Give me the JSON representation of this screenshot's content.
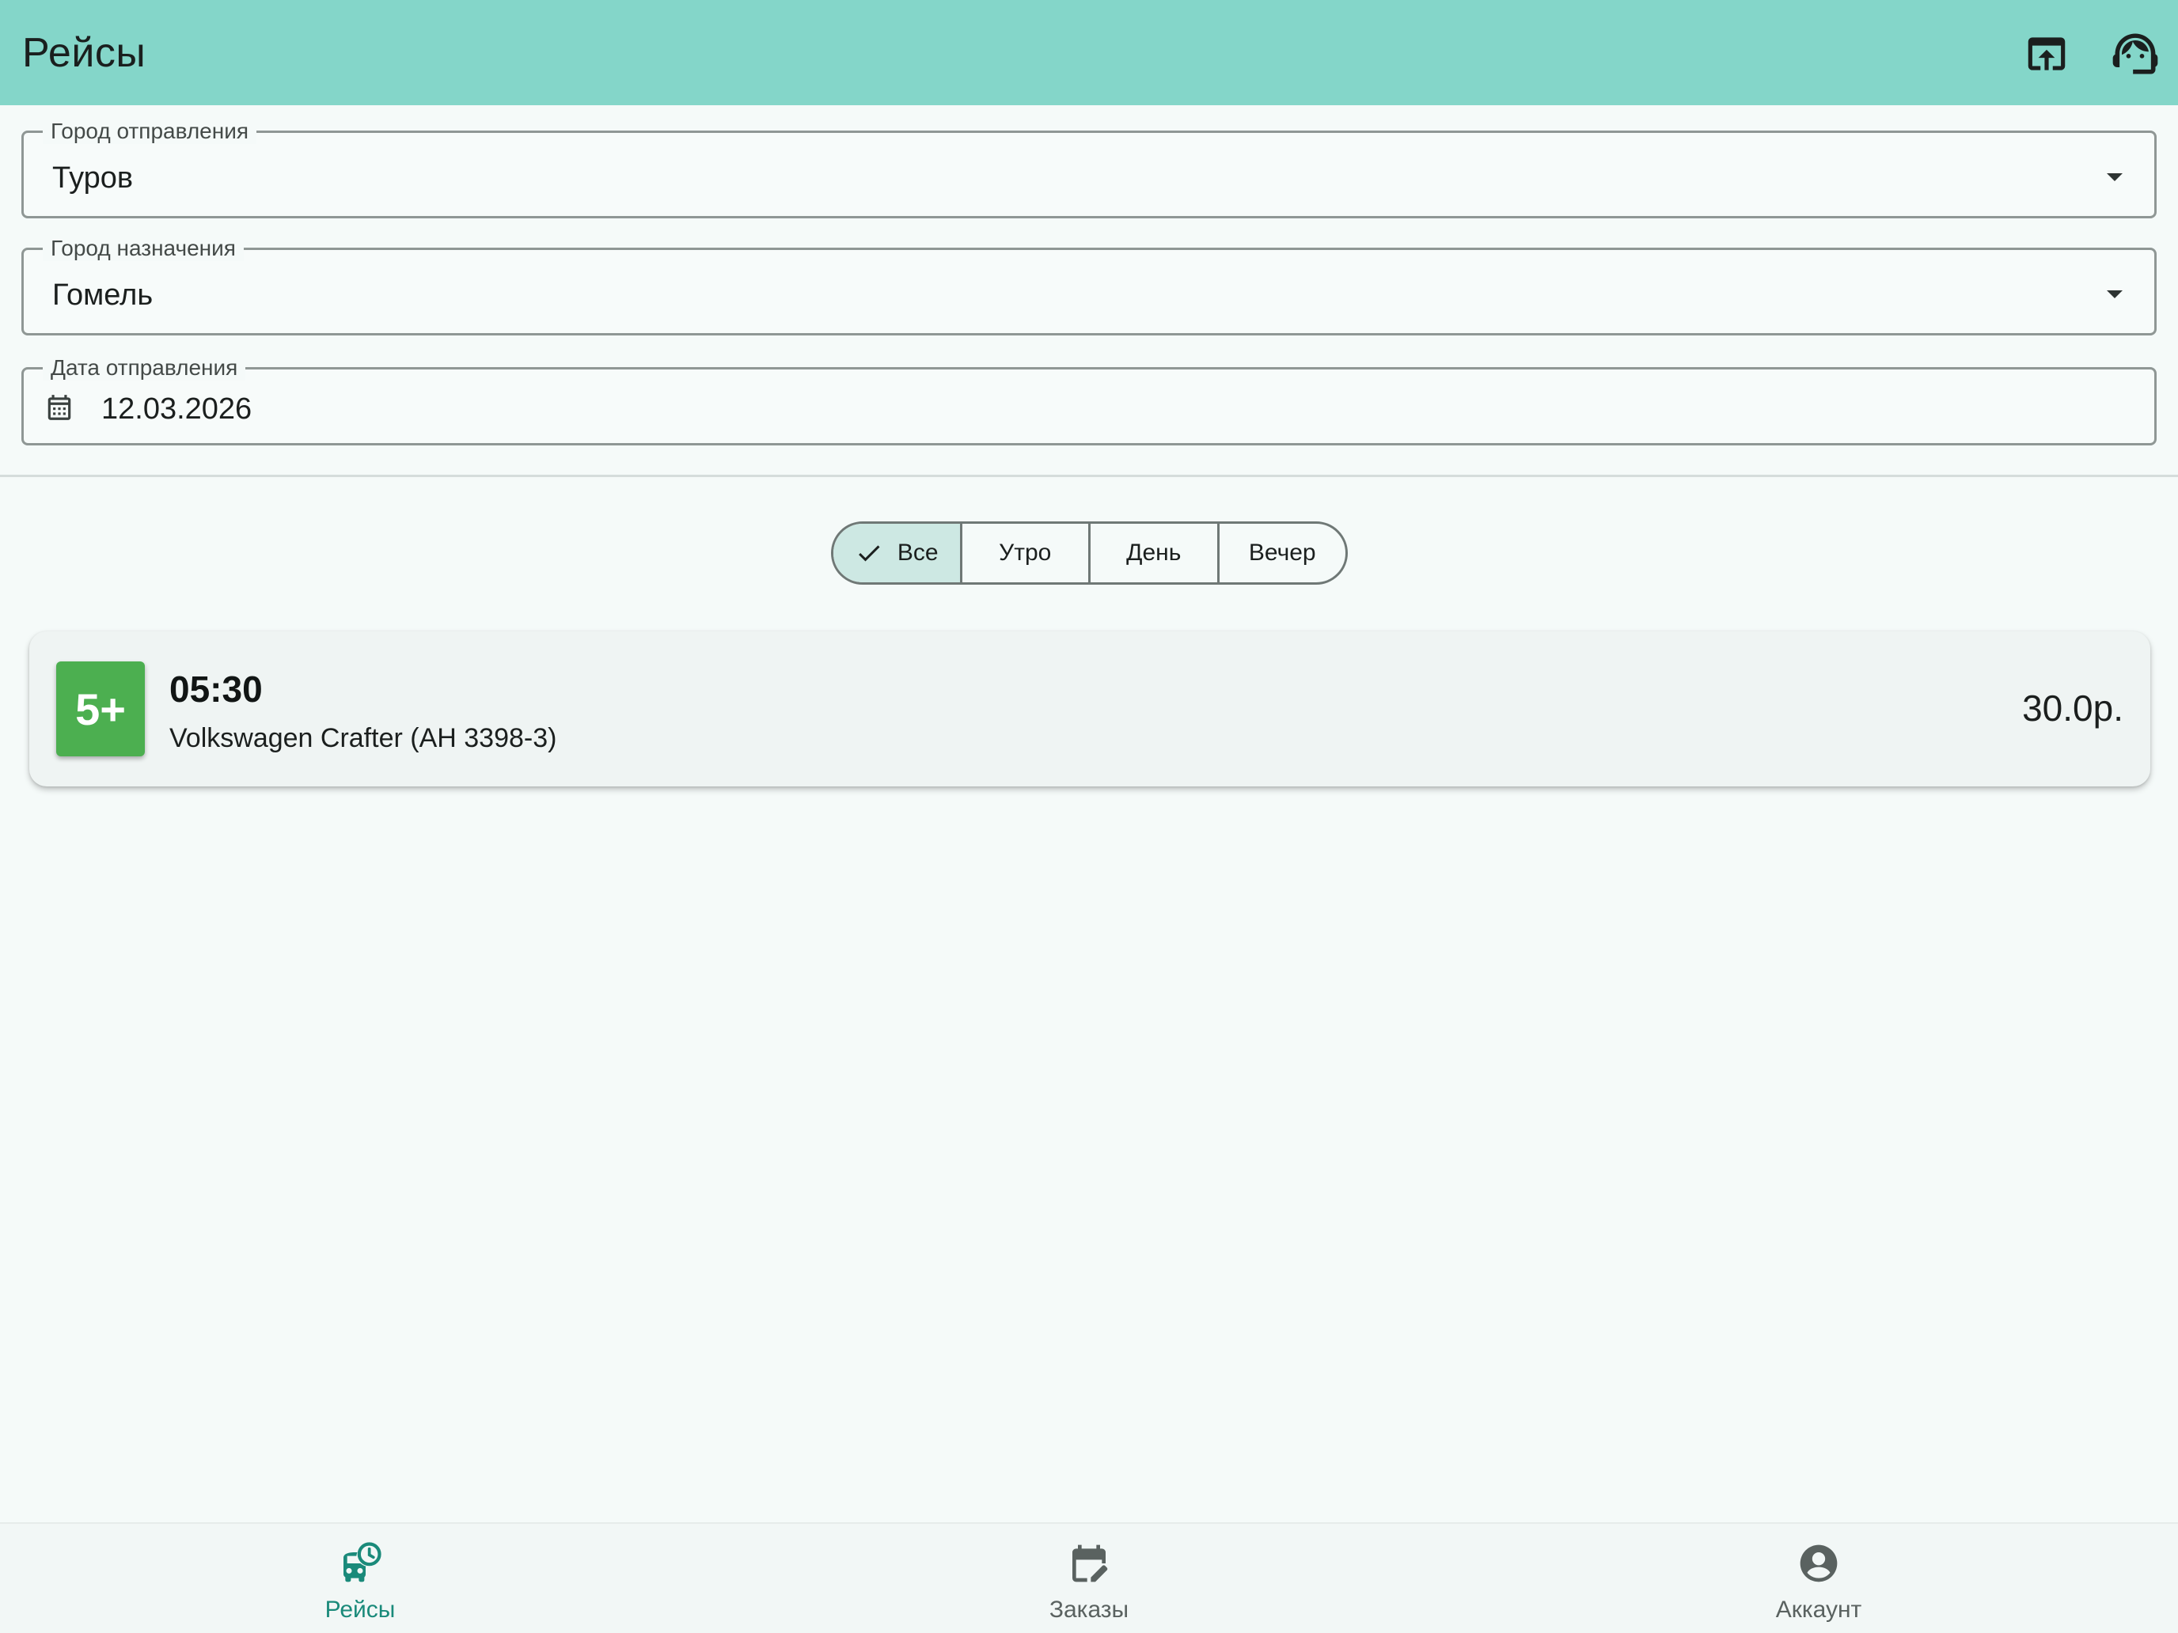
{
  "app_bar": {
    "title": "Рейсы",
    "actions": [
      {
        "icon": "open-in-browser-icon"
      },
      {
        "icon": "support-agent-icon"
      }
    ]
  },
  "form": {
    "departure_city": {
      "label": "Город отправления",
      "value": "Туров"
    },
    "destination_city": {
      "label": "Город назначения",
      "value": "Гомель"
    },
    "departure_date": {
      "label": "Дата отправления",
      "value": "12.03.2026",
      "icon": "calendar-icon"
    }
  },
  "time_filter": {
    "options": [
      {
        "label": "Все",
        "selected": true
      },
      {
        "label": "Утро",
        "selected": false
      },
      {
        "label": "День",
        "selected": false
      },
      {
        "label": "Вечер",
        "selected": false
      }
    ]
  },
  "trips": [
    {
      "seats": "5+",
      "time": "05:30",
      "vehicle": "Volkswagen Crafter (АН 3398-3)",
      "price": "30.0р."
    }
  ],
  "bottom_nav": {
    "items": [
      {
        "label": "Рейсы",
        "icon": "bus-schedule-icon",
        "active": true
      },
      {
        "label": "Заказы",
        "icon": "calendar-edit-icon",
        "active": false
      },
      {
        "label": "Аккаунт",
        "icon": "account-circle-icon",
        "active": false
      }
    ]
  },
  "colors": {
    "app_bar": "#84d6c9",
    "accent": "#1a8a7a",
    "seats_badge": "#4caf50",
    "segment_selected": "#cde8e3",
    "background": "#f5faf9"
  }
}
